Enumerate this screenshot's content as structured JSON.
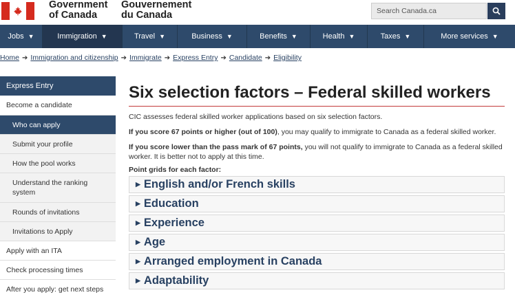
{
  "header": {
    "gov_en_line1": "Government",
    "gov_en_line2": "of Canada",
    "gov_fr_line1": "Gouvernement",
    "gov_fr_line2": "du Canada",
    "search_placeholder": "Search Canada.ca"
  },
  "nav": {
    "items": [
      {
        "label": "Jobs"
      },
      {
        "label": "Immigration"
      },
      {
        "label": "Travel"
      },
      {
        "label": "Business"
      },
      {
        "label": "Benefits"
      },
      {
        "label": "Health"
      },
      {
        "label": "Taxes"
      },
      {
        "label": "More services"
      }
    ]
  },
  "breadcrumb": [
    "Home",
    "Immigration and citizenship",
    "Immigrate",
    "Express Entry",
    "Candidate",
    "Eligibility"
  ],
  "sidebar": {
    "heading": "Express Entry",
    "items": [
      {
        "label": "Become a candidate"
      },
      {
        "label": "Who can apply"
      },
      {
        "label": "Submit your profile"
      },
      {
        "label": "How the pool works"
      },
      {
        "label": "Understand the ranking system"
      },
      {
        "label": "Rounds of invitations"
      },
      {
        "label": "Invitations to Apply"
      },
      {
        "label": "Apply with an ITA"
      },
      {
        "label": "Check processing times"
      },
      {
        "label": "After you apply: get next steps"
      }
    ]
  },
  "main": {
    "title": "Six selection factors – Federal skilled workers",
    "intro": "CIC assesses federal skilled worker applications based on six selection factors.",
    "p2_bold": "If you score 67 points or higher (out of 100)",
    "p2_rest": ", you may qualify to immigrate to Canada as a federal skilled worker.",
    "p3_bold": "If you score lower than the pass mark of 67 points,",
    "p3_rest": " you will not qualify to immigrate to Canada as a federal skilled worker. It is better not to apply at this time.",
    "grid_label": "Point grids for each factor:",
    "factors": [
      {
        "label": "English and/or French skills"
      },
      {
        "label": "Education"
      },
      {
        "label": "Experience"
      },
      {
        "label": "Age"
      },
      {
        "label": "Arranged employment in Canada"
      },
      {
        "label": "Adaptability"
      }
    ]
  }
}
